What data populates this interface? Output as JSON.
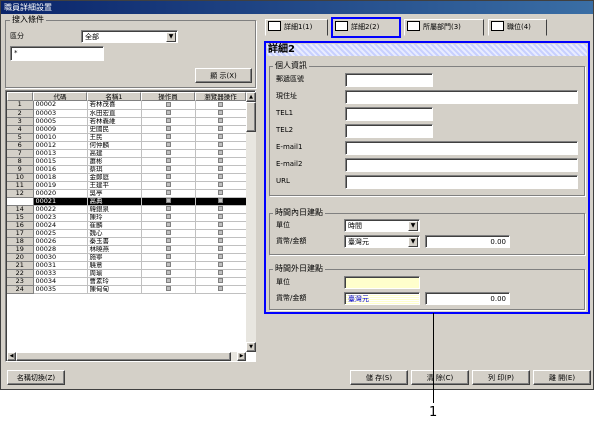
{
  "window": {
    "title": "職員詳細設置"
  },
  "filter": {
    "group_label": "搜入條件",
    "category_label": "區分",
    "category_value": "全部",
    "text_value": "*",
    "show_button": "顯 示(X)"
  },
  "grid": {
    "headers": [
      "代碼",
      "名稱1",
      "操作員",
      "瀏覽器操作"
    ],
    "rows": [
      {
        "n": "1",
        "code": "00002",
        "name": "若林茂喜"
      },
      {
        "n": "2",
        "code": "00003",
        "name": "水田宏直"
      },
      {
        "n": "3",
        "code": "00005",
        "name": "若林義維"
      },
      {
        "n": "4",
        "code": "00009",
        "name": "史國民"
      },
      {
        "n": "5",
        "code": "00010",
        "name": "王民"
      },
      {
        "n": "6",
        "code": "00012",
        "name": "何仲麟"
      },
      {
        "n": "7",
        "code": "00013",
        "name": "高建"
      },
      {
        "n": "8",
        "code": "00015",
        "name": "蕭彬"
      },
      {
        "n": "9",
        "code": "00016",
        "name": "蔡琪"
      },
      {
        "n": "10",
        "code": "00018",
        "name": "金鄭庭"
      },
      {
        "n": "11",
        "code": "00019",
        "name": "王建平"
      },
      {
        "n": "12",
        "code": "00020",
        "name": "吳亭"
      },
      {
        "n": "",
        "code": "00021",
        "name": "高典",
        "selected": true
      },
      {
        "n": "14",
        "code": "00022",
        "name": "韓銀泉"
      },
      {
        "n": "15",
        "code": "00023",
        "name": "陳玲"
      },
      {
        "n": "16",
        "code": "00024",
        "name": "崔麟"
      },
      {
        "n": "17",
        "code": "00025",
        "name": "魏心"
      },
      {
        "n": "18",
        "code": "00026",
        "name": "秦玉書"
      },
      {
        "n": "19",
        "code": "00028",
        "name": "林曉燕"
      },
      {
        "n": "20",
        "code": "00030",
        "name": "施寧"
      },
      {
        "n": "21",
        "code": "00031",
        "name": "驍意"
      },
      {
        "n": "22",
        "code": "00033",
        "name": "周瑜"
      },
      {
        "n": "23",
        "code": "00034",
        "name": "曹素玲"
      },
      {
        "n": "24",
        "code": "00035",
        "name": "陳甸甸"
      }
    ]
  },
  "name_switch_button": "名稱切換(Z)",
  "tabs": [
    "詳細1(1)",
    "詳細2(2)",
    "所屬部門(3)",
    "職位(4)"
  ],
  "detail2": {
    "title": "詳細2",
    "personal": {
      "legend": "個人資訊",
      "fields": [
        "郵遞區號",
        "現住址",
        "TEL1",
        "TEL2",
        "E-mail1",
        "E-mail2",
        "URL"
      ]
    },
    "inner_bill": {
      "legend": "時間內日建點",
      "unit_label": "單位",
      "unit_value": "時間",
      "currency_label": "貨幣/金額",
      "currency_value": "臺灣元",
      "amount": "0.00"
    },
    "outer_bill": {
      "legend": "時間外日建點",
      "unit_label": "單位",
      "currency_label": "貨幣/金額",
      "currency_value": "臺灣元",
      "amount": "0.00"
    }
  },
  "footer": {
    "save": "儲 存(S)",
    "clear": "清 除(C)",
    "print": "列 印(P)",
    "close": "離 開(E)"
  },
  "callout": {
    "label": "1"
  },
  "colors": {
    "highlight": "#0000ff",
    "selected_row": "#000000",
    "readonly_field": "#ffffcc"
  }
}
